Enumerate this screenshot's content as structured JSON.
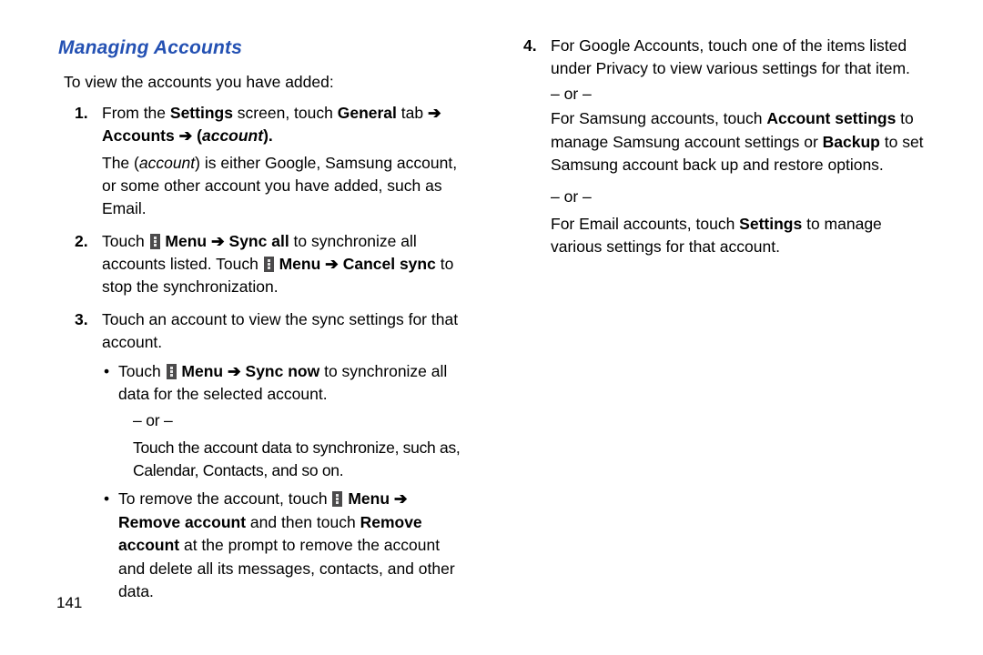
{
  "heading": "Managing Accounts",
  "intro": "To view the accounts you have added:",
  "step1_a": "From the ",
  "step1_settings": "Settings",
  "step1_b": " screen, touch ",
  "step1_general": "General",
  "step1_c": " tab ",
  "arrow": "➔",
  "step1_accounts": "Accounts",
  "step1_lp": " (",
  "step1_account_it": "account",
  "step1_rp": ").",
  "step1_desc_a": "The (",
  "step1_desc_it": "account",
  "step1_desc_b": ") is either Google, Samsung account, or some other account you have added, such as Email.",
  "step2_a": "Touch ",
  "step2_menu": " Menu ",
  "step2_syncall": "Sync all",
  "step2_b": " to synchronize all accounts listed. Touch ",
  "step2_cancel": "Cancel sync",
  "step2_c": " to stop the synchronization.",
  "step3": "Touch an account to view the sync settings for that account.",
  "b1_a": "Touch ",
  "b1_menu": " Menu ",
  "b1_syncnow": "Sync now",
  "b1_b": " to synchronize all data for the selected account.",
  "or": "– or –",
  "b1_sub": "Touch the account data to synchronize, such as, Calendar, Contacts, and so on.",
  "b2_a": "To remove the account, touch ",
  "b2_menu": " Menu ",
  "b2_remove": "Remove account",
  "b2_b": " and then touch ",
  "b2_remove2": "Remove account",
  "b2_c": " at the prompt to remove the account and delete all its messages, contacts, and other data.",
  "step4_a": "For Google Accounts, touch one of the items listed under Privacy to view various settings for that item.",
  "step4_samsung_a": "For Samsung accounts, touch ",
  "step4_acct_settings": "Account settings",
  "step4_samsung_b": " to manage Samsung account settings or ",
  "step4_backup": "Backup",
  "step4_samsung_c": " to set Samsung account back up and restore options.",
  "step4_email_a": "For Email accounts, touch ",
  "step4_settings": "Settings",
  "step4_email_b": " to manage various settings for that account.",
  "page_no": "141"
}
